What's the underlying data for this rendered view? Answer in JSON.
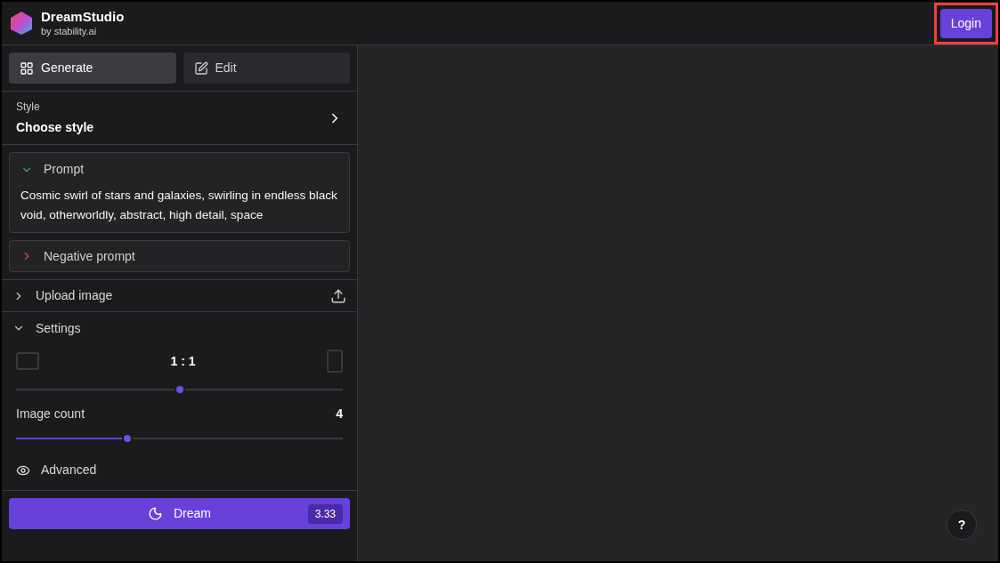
{
  "header": {
    "brand": "DreamStudio",
    "tagline": "by stability.ai",
    "login": "Login",
    "login_highlighted": true
  },
  "tabs": [
    {
      "label": "Generate",
      "selected": true,
      "kind": "grid"
    },
    {
      "label": "Edit",
      "selected": false,
      "kind": "edit"
    }
  ],
  "style": {
    "label": "Style",
    "value": "Choose style"
  },
  "prompt": {
    "label": "Prompt",
    "expanded": true,
    "text": "Cosmic swirl of stars and galaxies, swirling in endless black void, otherworldly, abstract, high detail, space"
  },
  "negative_prompt": {
    "label": "Negative prompt",
    "expanded": false
  },
  "upload": {
    "label": "Upload image",
    "expanded": false
  },
  "settings": {
    "label": "Settings",
    "expanded": true,
    "aspect": {
      "reading": "1 : 1",
      "level": 0.5
    },
    "image_count": {
      "label": "Image count",
      "reading": "4",
      "level": 0.34
    },
    "advanced": "Advanced"
  },
  "dream": {
    "label": "Dream",
    "cost": "3.33"
  },
  "help": "?"
}
